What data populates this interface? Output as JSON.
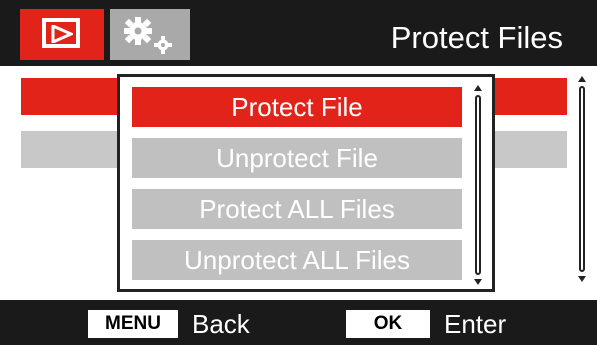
{
  "header": {
    "title": "Protect Files",
    "tabs": [
      {
        "icon": "playback-icon",
        "active": true
      },
      {
        "icon": "settings-gears-icon",
        "active": false
      }
    ]
  },
  "popup_menu": {
    "items": [
      {
        "label": "Protect File",
        "selected": true
      },
      {
        "label": "Unprotect File",
        "selected": false
      },
      {
        "label": "Protect ALL Files",
        "selected": false
      },
      {
        "label": "Unprotect ALL Files",
        "selected": false
      }
    ]
  },
  "footer": {
    "menu_key": "MENU",
    "menu_action": "Back",
    "ok_key": "OK",
    "ok_action": "Enter"
  },
  "colors": {
    "accent": "#e2231a",
    "bar": "#1a1a1a",
    "inactive_item": "#c0c0c0",
    "inactive_tab": "#a9a9a9"
  }
}
